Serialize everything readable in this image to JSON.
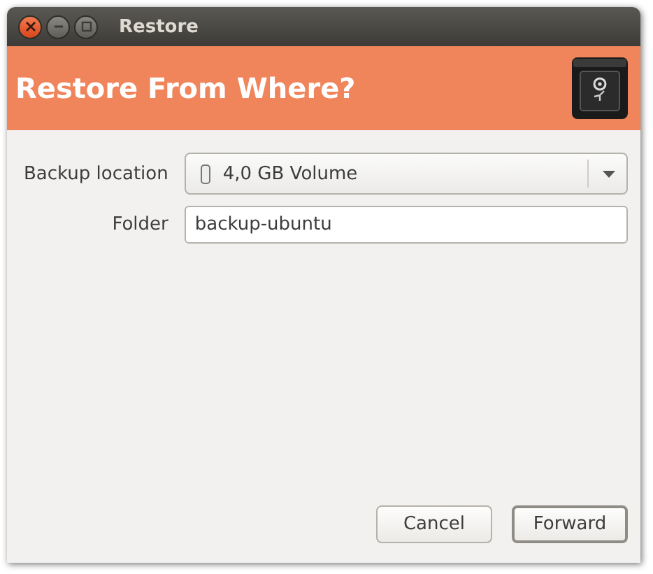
{
  "window": {
    "title": "Restore"
  },
  "header": {
    "title": "Restore From Where?"
  },
  "form": {
    "backup_location": {
      "label": "Backup location",
      "value": "4,0 GB Volume"
    },
    "folder": {
      "label": "Folder",
      "value": "backup-ubuntu"
    }
  },
  "buttons": [
    {
      "label": "Cancel",
      "default": false
    },
    {
      "label": "Forward",
      "default": true
    }
  ]
}
